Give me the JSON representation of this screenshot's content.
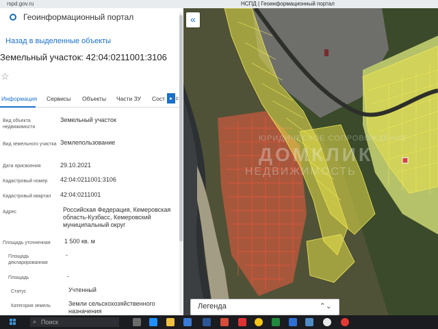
{
  "browser": {
    "url": "rspd.gov.ru",
    "tab_title": "НСПД | Геоинформационный портал"
  },
  "app": {
    "title": "Геоинформационный портал"
  },
  "panel": {
    "back_link": "Назад в выделенные объекты",
    "object_title": "Земельный участок: 42:04:0211001:3106",
    "tabs": [
      "Информация",
      "Сервисы",
      "Объекты",
      "Части ЗУ",
      "Сост"
    ],
    "tabs_more": "▸",
    "tabs_more2": "с",
    "attributes": [
      {
        "label": "Вид объекта недвижимости",
        "value": "Земельный участок"
      },
      {
        "label": "Вид земельного участка",
        "value": "Землепользование"
      },
      {
        "label": "Дата присвоения",
        "value": "29.10.2021"
      },
      {
        "label": "Кадастровый номер",
        "value": "42:04:0211001:3106"
      },
      {
        "label": "Кадастровый квартал",
        "value": "42:04:0211001"
      },
      {
        "label": "Адрес",
        "value": "Российская Федерация, Кемеровская область-Кузбасс, Кемеровский муниципальный округ"
      },
      {
        "label": "Площадь уточненная",
        "value": "1 500 кв. м"
      },
      {
        "label": "Площадь декларированная",
        "value": "-"
      },
      {
        "label": "Площадь",
        "value": "-"
      },
      {
        "label": "Статус",
        "value": "Учтенный"
      },
      {
        "label": "Категория земель",
        "value": "Земли сельскохозяйственного назначения"
      }
    ]
  },
  "map": {
    "collapse_icon": "«",
    "watermark": {
      "line1": "ЮРИДИЧЕСКОЕ СОПРОВОЖДЕНИЕ",
      "line2": "ДОМКЛИК",
      "line3": "НЕДВИЖИМОСТЬ"
    },
    "legend_label": "Легенда",
    "legend_chevron": "⌃⌄"
  },
  "taskbar": {
    "search_placeholder": "Поиск"
  },
  "colors": {
    "accent": "#1a6fc9",
    "parcel_yellow": "#e6e04a",
    "parcel_red": "#d9543a"
  }
}
